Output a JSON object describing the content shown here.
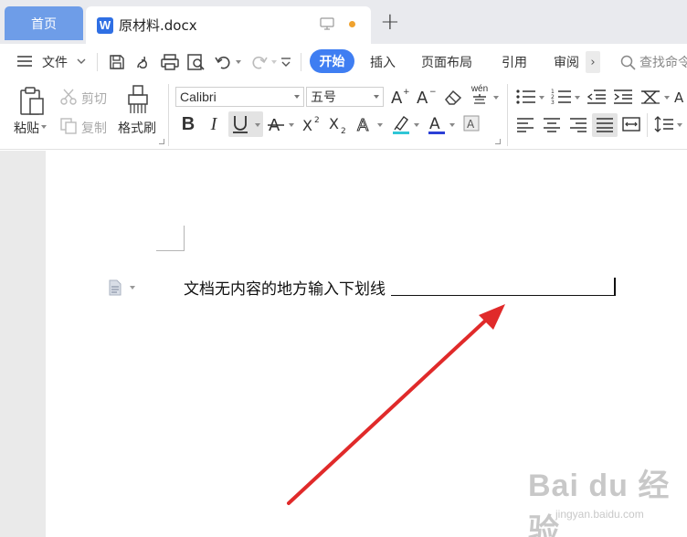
{
  "tabs": {
    "home_label": "首页",
    "doc_badge": "W",
    "doc_title": "原材料.docx",
    "new_tab": "+"
  },
  "menubar": {
    "file_label": "文件",
    "items": [
      "开始",
      "插入",
      "页面布局",
      "引用",
      "审阅"
    ],
    "more": "›",
    "search_placeholder": "查找命令"
  },
  "ribbon": {
    "paste_label": "粘贴",
    "cut_label": "剪切",
    "copy_label": "复制",
    "format_painter_label": "格式刷",
    "font_name": "Calibri",
    "font_size": "五号",
    "pinyin_glyph": "wén"
  },
  "document": {
    "text": "文档无内容的地方输入下划线"
  },
  "watermark": {
    "main": "Bai du 经验",
    "sub": "jingyan.baidu.com"
  },
  "colors": {
    "accent": "#3f7ef2",
    "home_tab": "#6e9de8",
    "arrow": "#e02a2a",
    "highlight": "#2fc6d6",
    "font_color": "#2b3fd6"
  }
}
